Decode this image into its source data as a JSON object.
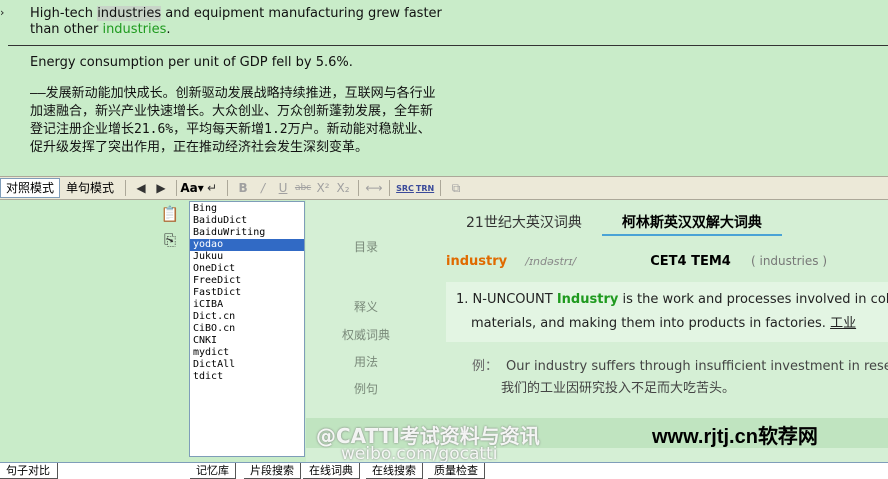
{
  "editor": {
    "source": {
      "p1": "High-tech ",
      "hl1": "industries",
      "p2": " and equipment manufacturing grew faster than other ",
      "hl2": "industries",
      "p3": "."
    },
    "energy": "Energy consumption per unit of GDP fell by 5.6%.",
    "chinese": "——发展新动能加快成长。创新驱动发展战略持续推进，互联网与各行业加速融合，新兴产业快速增长。大众创业、万众创新蓬勃发展，全年新登记注册企业增长21.6%，平均每天新增1.2万户。新动能对稳就业、促升级发挥了突出作用，正在推动经济社会发生深刻变革。"
  },
  "toolbar": {
    "tab_compare": "对照模式",
    "tab_single": "单句模式",
    "font_aa": "Aa",
    "src_label": "SRC",
    "trn_label": "TRN"
  },
  "dictionaries": [
    "Bing",
    "BaiduDict",
    "BaiduWriting",
    "yodao",
    "Jukuu",
    "OneDict",
    "FreeDict",
    "FastDict",
    "iCIBA",
    "Dict.cn",
    "CiBO.cn",
    "CNKI",
    "mydict",
    "DictAll",
    "tdict"
  ],
  "selected_dictionary": "yodao",
  "dict_view": {
    "nav": [
      "目录",
      "释义",
      "权威词典",
      "用法",
      "例句"
    ],
    "tabs": [
      "21世纪大英汉词典",
      "柯林斯英汉双解大词典"
    ],
    "headword": "industry",
    "phonetic": "/ɪndəstrɪ/",
    "level": "CET4 TEM4",
    "forms": "( industries )",
    "sense_num": "1.",
    "sense_type": "N-UNCOUNT",
    "sense_kw": "Industry",
    "sense_text1": " is the work and processes involved in collec",
    "sense_text2": "materials, and making them into products in factories. ",
    "sense_cn": "工业",
    "example_label": "例：",
    "example_en": "Our industry suffers through insufficient investment in research",
    "example_cn": "我们的工业因研究投入不足而大吃苦头。"
  },
  "watermark": {
    "text": "@CATTI考试资料与资讯",
    "url": "www.rjtj.cn软荐网",
    "sub": "weibo.com/gocatti"
  },
  "bottom_tabs": [
    "句子对比",
    "记忆库",
    "片段搜索",
    "在线词典",
    "在线搜索",
    "质量检查"
  ]
}
